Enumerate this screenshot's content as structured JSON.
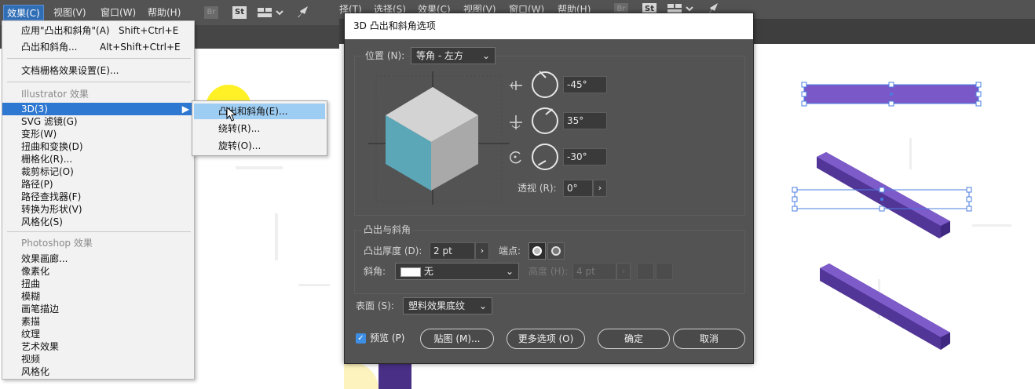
{
  "left_menubar": {
    "items": [
      "效果(C)",
      "视图(V)",
      "窗口(W)",
      "帮助(H)"
    ],
    "toolbar_icons": [
      "Br",
      "St"
    ]
  },
  "effects_menu": {
    "apply_last": {
      "label": "应用\"凸出和斜角\"(A)",
      "shortcut": "Shift+Ctrl+E"
    },
    "last_effect": {
      "label": "凸出和斜角...",
      "shortcut": "Alt+Shift+Ctrl+E"
    },
    "doc_raster": "文档栅格效果设置(E)...",
    "illustrator_header": "Illustrator 效果",
    "illustrator_items": [
      "3D(3)",
      "SVG 滤镜(G)",
      "变形(W)",
      "扭曲和变换(D)",
      "栅格化(R)...",
      "裁剪标记(O)",
      "路径(P)",
      "路径查找器(F)",
      "转换为形状(V)",
      "风格化(S)"
    ],
    "photoshop_header": "Photoshop 效果",
    "photoshop_items": [
      "效果画廊...",
      "像素化",
      "扭曲",
      "模糊",
      "画笔描边",
      "素描",
      "纹理",
      "艺术效果",
      "视频",
      "风格化"
    ]
  },
  "submenu_3d": {
    "items": [
      "凸出和斜角(E)...",
      "绕转(R)...",
      "旋转(O)..."
    ]
  },
  "right_menubar": {
    "items": [
      "择(T)",
      "选择(S)",
      "效果(C)",
      "视图(V)",
      "窗口(W)",
      "帮助(H)"
    ],
    "toolbar_icons": [
      "Br",
      "St"
    ]
  },
  "dialog": {
    "title": "3D 凸出和斜角选项",
    "position_label": "位置 (N):",
    "position_value": "等角 - 左方",
    "rot_x": "-45°",
    "rot_y": "35°",
    "rot_z": "-30°",
    "perspective_label": "透视 (R):",
    "perspective_value": "0°",
    "extrude_section": "凸出与斜角",
    "extrude_depth_label": "凸出厚度 (D):",
    "extrude_depth_value": "2 pt",
    "cap_label": "端点:",
    "bevel_label": "斜角:",
    "bevel_value": "无",
    "height_label": "高度 (H):",
    "height_value": "4 pt",
    "surface_label": "表面 (S):",
    "surface_value": "塑料效果底纹",
    "preview_label": "预览 (P)",
    "preview_checked": true,
    "map_button": "贴图 (M)...",
    "more_options_button": "更多选项 (O)",
    "ok_button": "确定",
    "cancel_button": "取消"
  },
  "colors": {
    "bar_fill": "#7b58c8",
    "bar_top": "#7d5bc9",
    "bar_side": "#513597",
    "cube_top": "#d3d3d3",
    "cube_left": "#5ba7b8",
    "cube_right": "#a9a9a9",
    "selection": "#4a7ee0",
    "menu_highlight": "#2f78d2",
    "submenu_hover": "#9ecdf3",
    "cursor_highlight": "#ffee00"
  }
}
